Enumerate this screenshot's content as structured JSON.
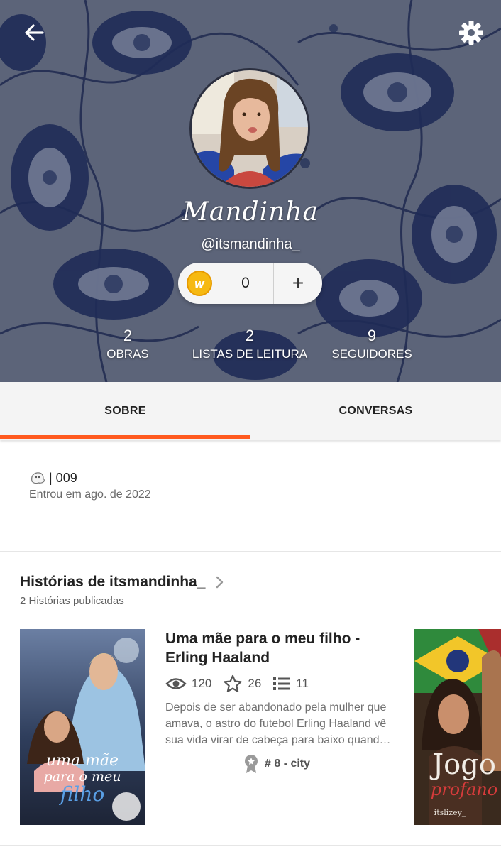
{
  "profile": {
    "display_name": "Mandinha",
    "handle": "@itsmandinha_",
    "coins": {
      "count": "0",
      "coin_letter": "w",
      "add_symbol": "+"
    },
    "stats": [
      {
        "value": "2",
        "label": "OBRAS"
      },
      {
        "value": "2",
        "label": "LISTAS DE LEITURA"
      },
      {
        "value": "9",
        "label": "SEGUIDORES"
      }
    ]
  },
  "tabs": [
    {
      "label": "SOBRE",
      "active": true
    },
    {
      "label": "CONVERSAS",
      "active": false
    }
  ],
  "about": {
    "description": "| 009",
    "joined": "Entrou em ago. de 2022"
  },
  "stories_section": {
    "title": "Histórias de itsmandinha_",
    "subtitle": "2 Histórias publicadas",
    "stories": [
      {
        "title": "Uma mãe para o meu filho - Erling Haaland",
        "reads": "120",
        "votes": "26",
        "parts": "11",
        "description": "Depois de ser abandonado pela mulher que amava, o astro do futebol Erling Haaland vê sua vida virar de cabeça para baixo quando descobre que é pai...",
        "tag": "# 8 - city",
        "cover_text": [
          "uma mãe",
          "para o meu",
          "filho"
        ]
      },
      {
        "cover_text": [
          "Jogo",
          "profano"
        ],
        "cover_author": "itslizey_"
      }
    ]
  },
  "colors": {
    "accent": "#ff5a1f",
    "header_bg": "#5b6479",
    "coin": "#f6b912"
  },
  "icons": {
    "back": "arrow-left-icon",
    "settings": "gear-icon",
    "add": "plus-icon",
    "reads": "eye-icon",
    "votes": "star-icon",
    "parts": "list-icon",
    "tag": "ribbon-icon",
    "more": "chevron-right-icon"
  }
}
